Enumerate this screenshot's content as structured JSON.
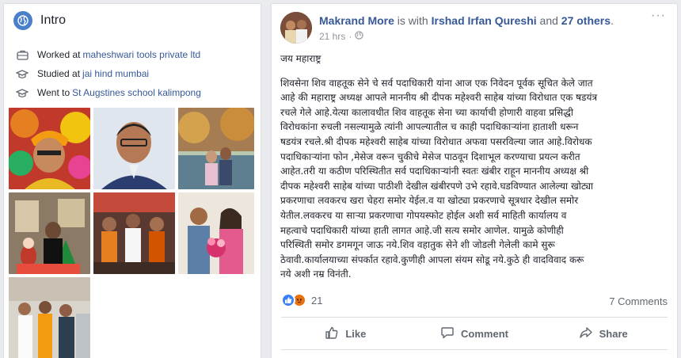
{
  "intro": {
    "title": "Intro",
    "items": [
      {
        "icon": "briefcase-icon",
        "prefix": "Worked at",
        "link": "maheshwari tools private ltd"
      },
      {
        "icon": "graduation-cap-icon",
        "prefix": "Studied at",
        "link": "jai hind mumbai"
      },
      {
        "icon": "graduation-cap-icon",
        "prefix": "Went to",
        "link": "St Augstines school kalimpong"
      }
    ]
  },
  "post": {
    "author": "Makrand More",
    "with_text": " is with ",
    "tagged": "Irshad Irfan Qureshi",
    "and_text": " and ",
    "others": "27 others",
    "period": ".",
    "time": "21 hrs",
    "greeting": "जय महाराष्ट्र",
    "body": "शिवसेना शिव वाहतूक सेने चे सर्व पदाधिकारी यांना आज एक निवेदन पूर्वक सूचित केले जात\nआहे की महाराष्ट्र अध्यक्ष आपले माननीय श्री दीपक महेश्वरी साहेब यांच्या विरोधात एक षडयंत्र\nरचले गेले आहे.येत्या कालावधीत शिव वाहतूक सेना च्या कार्याची होणारी वाहवा प्रसिद्धी\nविरोधकांना रुचली नसल्यामुळे त्यांनी आपल्यातील च काही पदाधिकाऱ्यांना हाताशी धरून\nषडयंत्र रचले.श्री दीपक महेश्वरी साहेब यांच्या विरोधात अफवा पसरविल्या जात आहे.विरोधक\nपदाधिकाऱ्यांना फोन ,मेसेज वरून चुकीचे मेसेज पाठवून दिशाभूल करण्याचा प्रयत्न करीत\nआहेत.तरी या कठीण परिस्थितीत सर्व पदाधिकाऱ्यांनी स्वतः खंबीर राहून माननीय अध्यक्ष श्री\nदीपक महेश्वरी साहेब यांच्या पाठीशी देखील खंबीरपणे उभे रहावे.घडविण्यात आलेल्या खोट्या\nप्रकरणाचा लवकरच खरा चेहरा समोर येईल.व या खोट्या प्रकरणाचे सूत्रधार देखील समोर\nयेतील.लवकरच या साऱ्या प्रकरणाचा गोपयस्फोट होईल अशी सर्व माहिती कार्यालय व\nमहत्वाचे पदाधिकारी यांच्या हाती लागत आहे.जी सत्य समोर आणेल. यामुळे कोणीही\nपरिस्थिती समोर डगमगून जाऊ नये.शिव वहातुक सेने शी जोडली गेलेली कामे सुरू\nठेवावी.कार्यालयाच्या संपर्कात रहावे.कुणीही आपला संयम सोडू नये.कुठे ही वादविवाद करू\nनये अशी नम्र विनंती.",
    "reaction_count": "21",
    "comments_count": "7 Comments",
    "actions": {
      "like": "Like",
      "comment": "Comment",
      "share": "Share"
    }
  },
  "colors": {
    "link": "#365899",
    "accent": "#4267b2",
    "page_bg": "#e9ebee"
  }
}
